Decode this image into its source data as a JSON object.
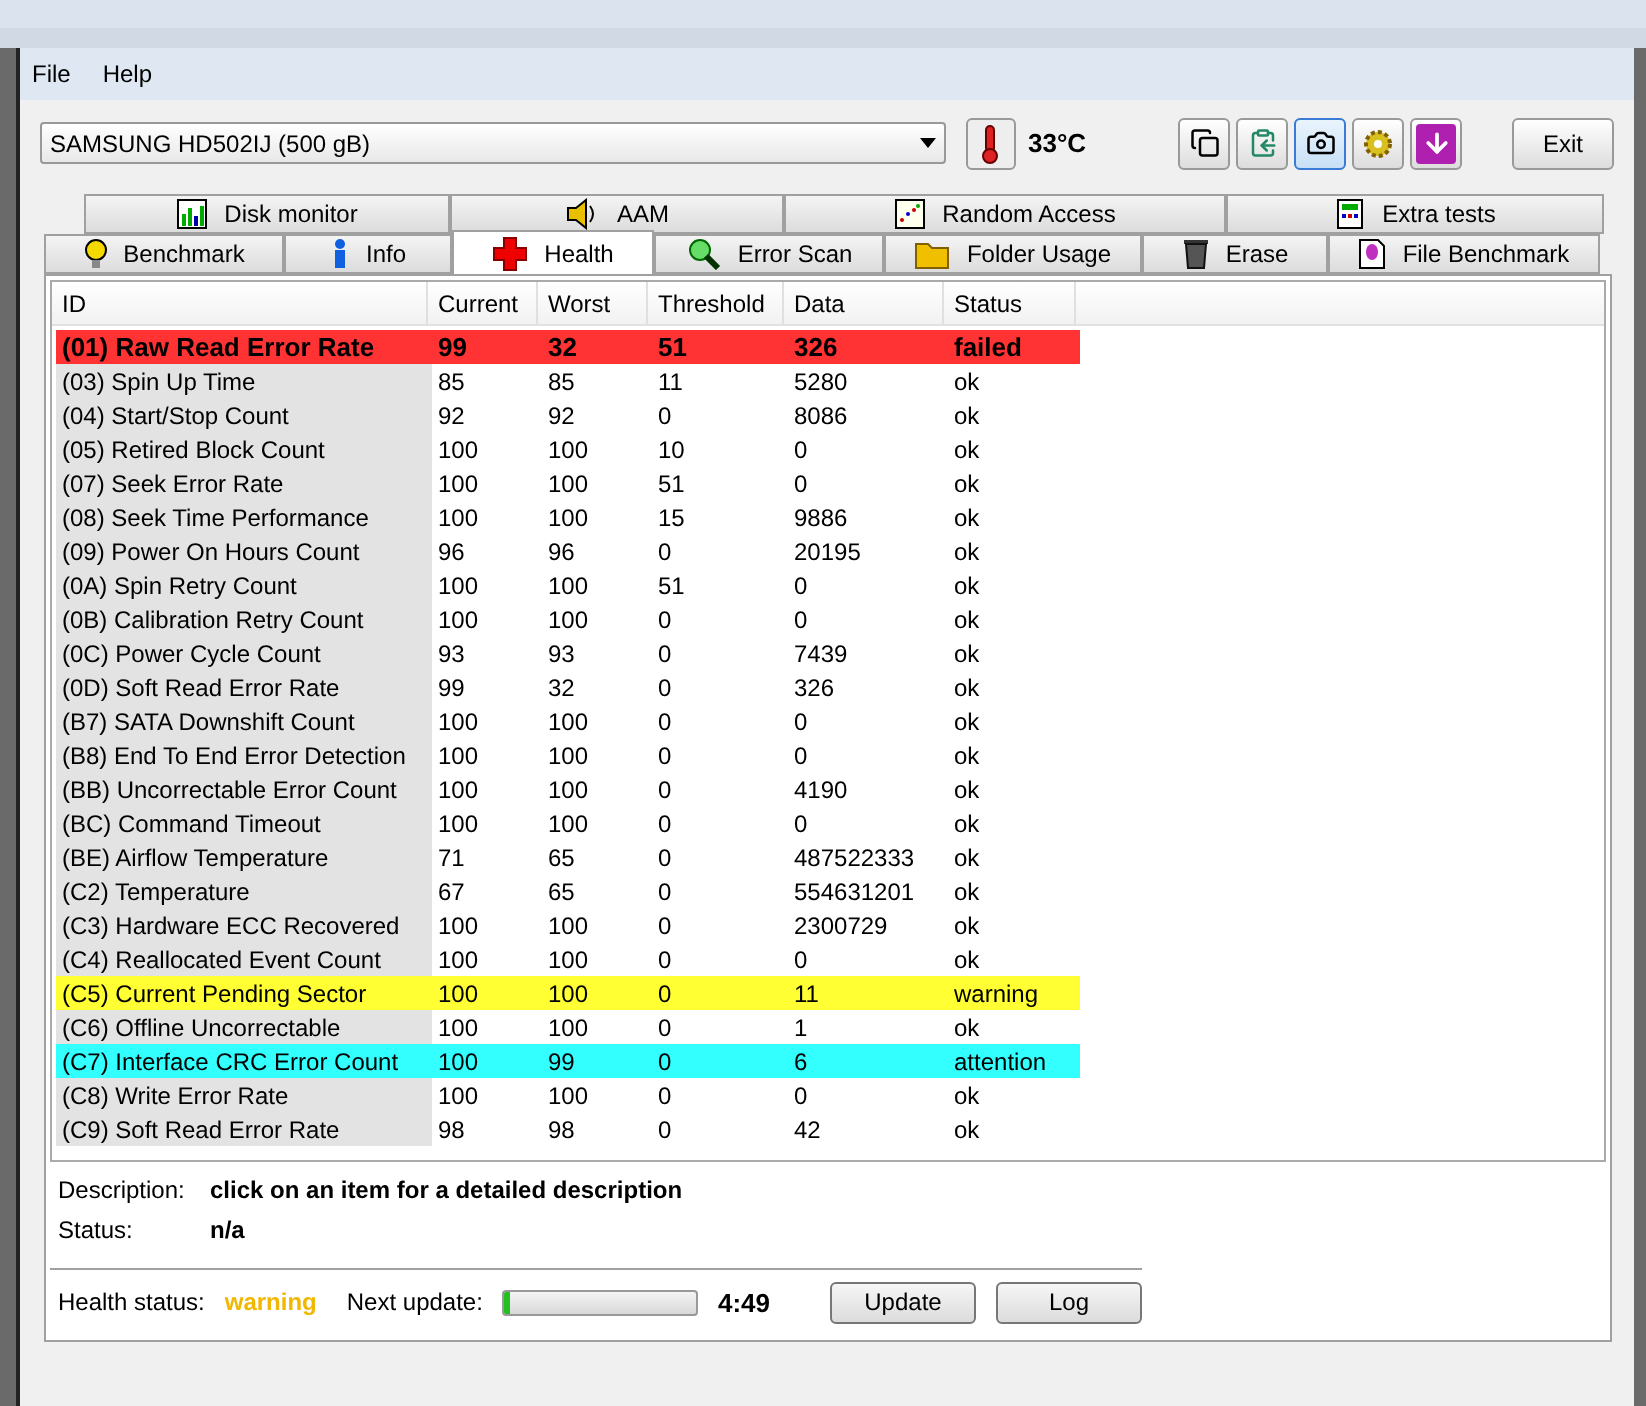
{
  "menu": [
    {
      "label": "File"
    },
    {
      "label": "Help"
    }
  ],
  "toolbar": {
    "drive": "SAMSUNG HD502IJ (500 gB)",
    "temperature": "33°C",
    "exit": "Exit"
  },
  "tabs_top": [
    {
      "label": "Disk monitor",
      "selected": false
    },
    {
      "label": "AAM",
      "selected": false
    },
    {
      "label": "Random Access",
      "selected": false
    },
    {
      "label": "Extra tests",
      "selected": false
    }
  ],
  "tabs": [
    {
      "label": "Benchmark",
      "selected": false
    },
    {
      "label": "Info",
      "selected": false
    },
    {
      "label": "Health",
      "selected": true
    },
    {
      "label": "Error Scan",
      "selected": false
    },
    {
      "label": "Folder Usage",
      "selected": false
    },
    {
      "label": "Erase",
      "selected": false
    },
    {
      "label": "File Benchmark",
      "selected": false
    }
  ],
  "table": {
    "columns": [
      "ID",
      "Current",
      "Worst",
      "Threshold",
      "Data",
      "Status"
    ],
    "rows": [
      {
        "kind": "failed",
        "cells": [
          "(01) Raw Read Error Rate",
          "99",
          "32",
          "51",
          "326",
          "failed"
        ]
      },
      {
        "kind": "ok",
        "cells": [
          "(03) Spin Up Time",
          "85",
          "85",
          "11",
          "5280",
          "ok"
        ]
      },
      {
        "kind": "ok",
        "cells": [
          "(04) Start/Stop Count",
          "92",
          "92",
          "0",
          "8086",
          "ok"
        ]
      },
      {
        "kind": "ok",
        "cells": [
          "(05) Retired Block Count",
          "100",
          "100",
          "10",
          "0",
          "ok"
        ]
      },
      {
        "kind": "ok",
        "cells": [
          "(07) Seek Error Rate",
          "100",
          "100",
          "51",
          "0",
          "ok"
        ]
      },
      {
        "kind": "ok",
        "cells": [
          "(08) Seek Time Performance",
          "100",
          "100",
          "15",
          "9886",
          "ok"
        ]
      },
      {
        "kind": "ok",
        "cells": [
          "(09) Power On Hours Count",
          "96",
          "96",
          "0",
          "20195",
          "ok"
        ]
      },
      {
        "kind": "ok",
        "cells": [
          "(0A) Spin Retry Count",
          "100",
          "100",
          "51",
          "0",
          "ok"
        ]
      },
      {
        "kind": "ok",
        "cells": [
          "(0B) Calibration Retry Count",
          "100",
          "100",
          "0",
          "0",
          "ok"
        ]
      },
      {
        "kind": "ok",
        "cells": [
          "(0C) Power Cycle Count",
          "93",
          "93",
          "0",
          "7439",
          "ok"
        ]
      },
      {
        "kind": "ok",
        "cells": [
          "(0D) Soft Read Error Rate",
          "99",
          "32",
          "0",
          "326",
          "ok"
        ]
      },
      {
        "kind": "ok",
        "cells": [
          "(B7) SATA Downshift Count",
          "100",
          "100",
          "0",
          "0",
          "ok"
        ]
      },
      {
        "kind": "ok",
        "cells": [
          "(B8) End To End Error Detection",
          "100",
          "100",
          "0",
          "0",
          "ok"
        ]
      },
      {
        "kind": "ok",
        "cells": [
          "(BB) Uncorrectable Error Count",
          "100",
          "100",
          "0",
          "4190",
          "ok"
        ]
      },
      {
        "kind": "ok",
        "cells": [
          "(BC) Command Timeout",
          "100",
          "100",
          "0",
          "0",
          "ok"
        ]
      },
      {
        "kind": "ok",
        "cells": [
          "(BE) Airflow Temperature",
          "71",
          "65",
          "0",
          "487522333",
          "ok"
        ]
      },
      {
        "kind": "ok",
        "cells": [
          "(C2) Temperature",
          "67",
          "65",
          "0",
          "554631201",
          "ok"
        ]
      },
      {
        "kind": "ok",
        "cells": [
          "(C3) Hardware ECC Recovered",
          "100",
          "100",
          "0",
          "2300729",
          "ok"
        ]
      },
      {
        "kind": "ok",
        "cells": [
          "(C4) Reallocated Event Count",
          "100",
          "100",
          "0",
          "0",
          "ok"
        ]
      },
      {
        "kind": "warning",
        "cells": [
          "(C5) Current Pending Sector",
          "100",
          "100",
          "0",
          "11",
          "warning"
        ]
      },
      {
        "kind": "ok",
        "cells": [
          "(C6) Offline Uncorrectable",
          "100",
          "100",
          "0",
          "1",
          "ok"
        ]
      },
      {
        "kind": "attention",
        "cells": [
          "(C7) Interface CRC Error Count",
          "100",
          "99",
          "0",
          "6",
          "attention"
        ]
      },
      {
        "kind": "ok",
        "cells": [
          "(C8) Write Error Rate",
          "100",
          "100",
          "0",
          "0",
          "ok"
        ]
      },
      {
        "kind": "ok",
        "cells": [
          "(C9) Soft Read Error Rate",
          "98",
          "98",
          "0",
          "42",
          "ok"
        ]
      }
    ]
  },
  "details": {
    "description_label": "Description:",
    "description": "click on an item for a detailed description",
    "status_label": "Status:",
    "status": "n/a"
  },
  "footer": {
    "health_label": "Health status:",
    "health": "warning",
    "next_label": "Next update:",
    "level": 0.03,
    "time": "4:49",
    "buttons": [
      "Update",
      "Log"
    ]
  }
}
